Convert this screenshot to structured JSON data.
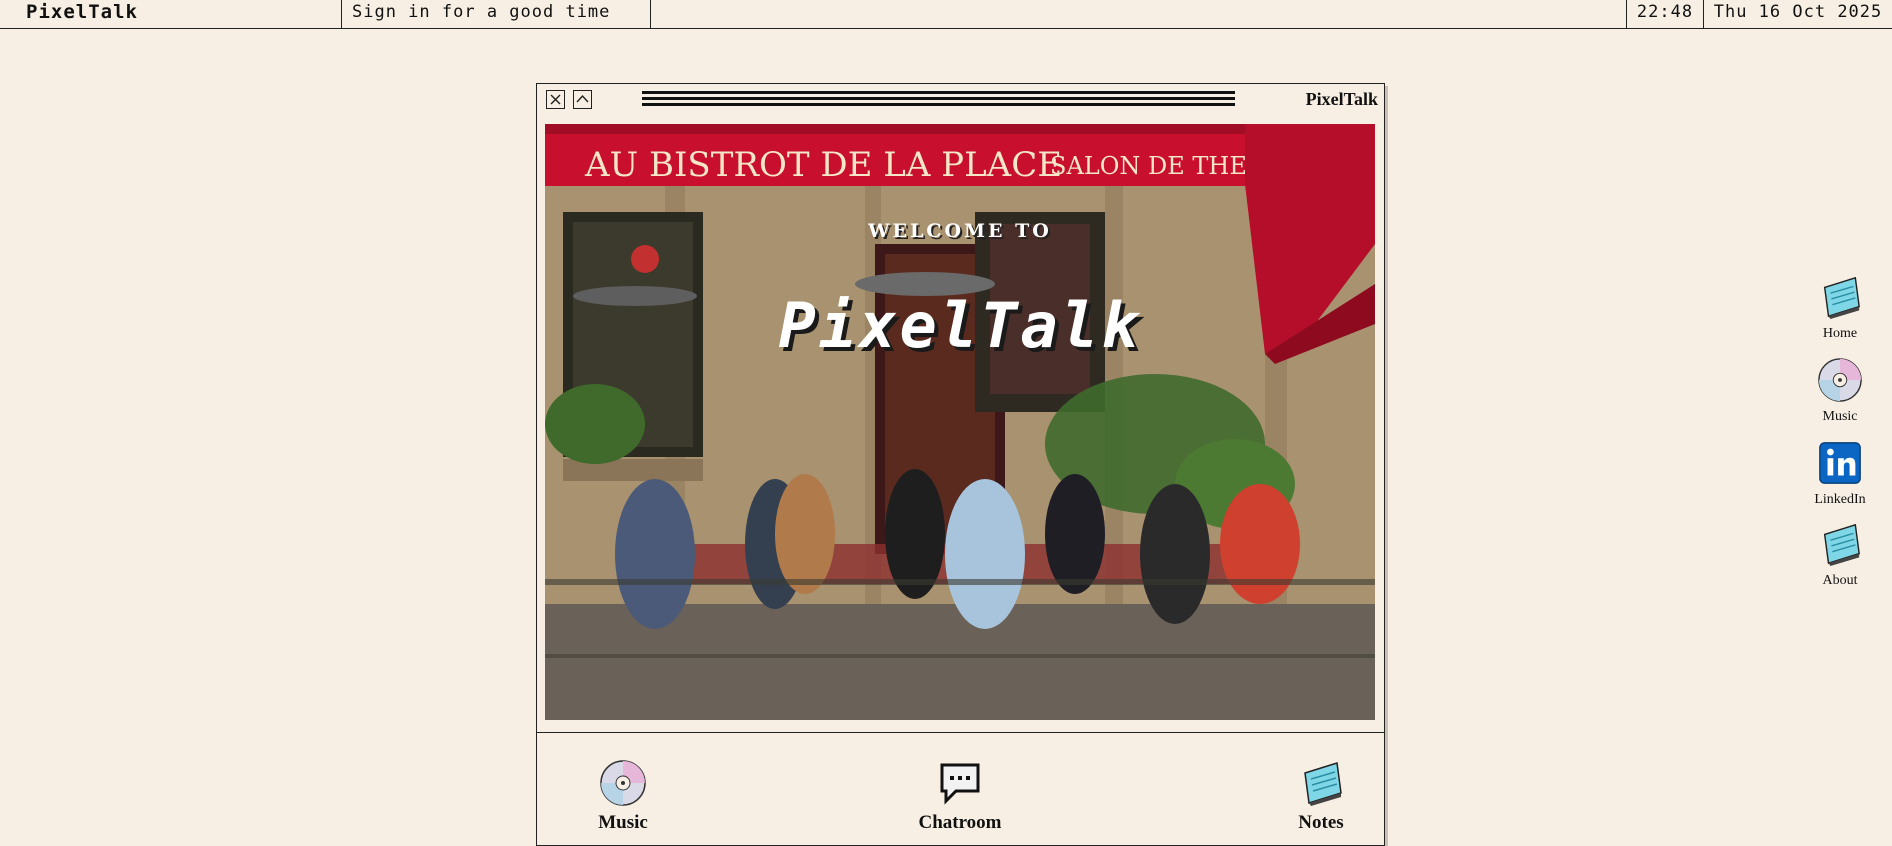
{
  "topbar": {
    "brand": "PixelTalk",
    "tagline": "Sign in for a good time",
    "time": "22:48",
    "date": "Thu 16 Oct 2025"
  },
  "window": {
    "title": "PixelTalk",
    "close_icon": "close-icon",
    "maximize_icon": "chevron-up-icon",
    "hero": {
      "welcome": "WELCOME TO",
      "title": "PixelTalk",
      "sign_text": "AU BISTROT DE LA PLACE",
      "sign_text_2": "SALON DE THE"
    },
    "dock": [
      {
        "label": "Music",
        "icon": "cd-icon"
      },
      {
        "label": "Chatroom",
        "icon": "speech-bubble-icon"
      },
      {
        "label": "Notes",
        "icon": "notepad-icon"
      }
    ]
  },
  "desktop_icons": [
    {
      "label": "Home",
      "icon": "notepad-icon"
    },
    {
      "label": "Music",
      "icon": "cd-icon"
    },
    {
      "label": "LinkedIn",
      "icon": "linkedin-icon"
    },
    {
      "label": "About",
      "icon": "notepad-icon"
    }
  ],
  "colors": {
    "background": "#f7efe4",
    "awning_red": "#c8102e",
    "sign_text": "#f5e6c8",
    "linkedin_blue": "#0a66c2",
    "notepad_cyan": "#7fd6e6"
  }
}
